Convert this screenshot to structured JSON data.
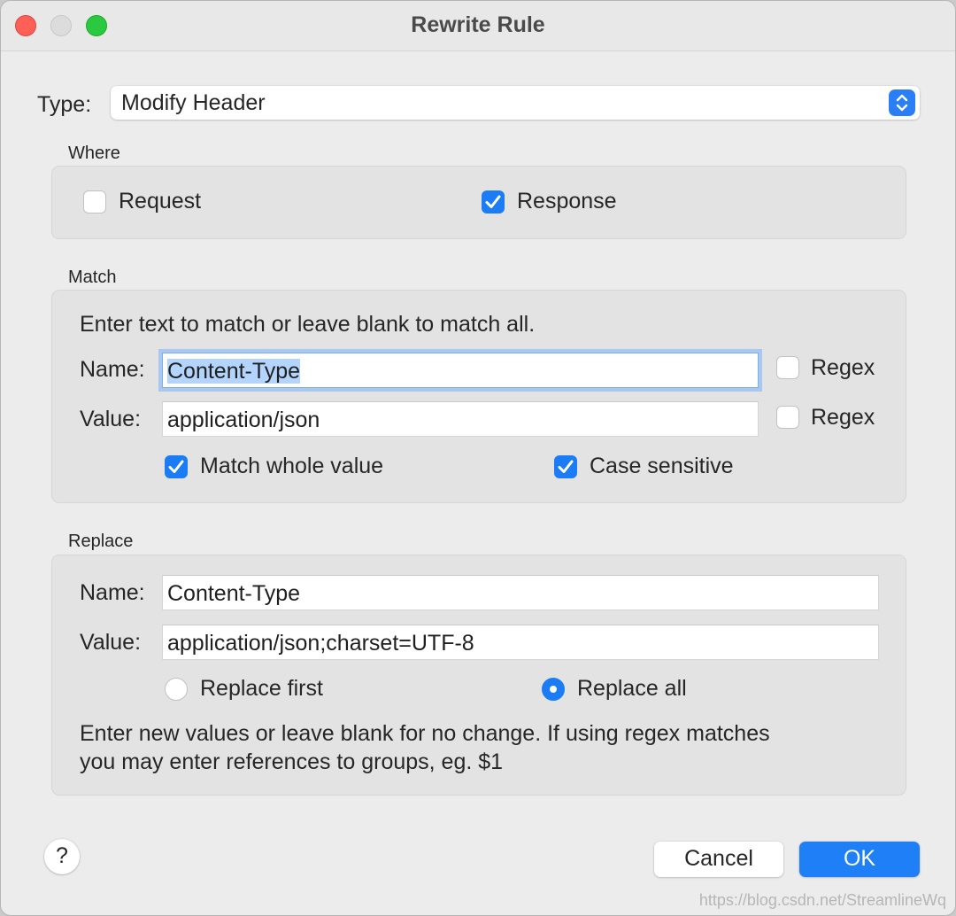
{
  "window": {
    "title": "Rewrite Rule"
  },
  "type": {
    "label": "Type:",
    "value": "Modify Header"
  },
  "where": {
    "section_label": "Where",
    "request": {
      "label": "Request",
      "checked": false
    },
    "response": {
      "label": "Response",
      "checked": true
    }
  },
  "match": {
    "section_label": "Match",
    "hint": "Enter text to match or leave blank to match all.",
    "name_label": "Name:",
    "name_value": "Content-Type",
    "name_regex": {
      "label": "Regex",
      "checked": false
    },
    "value_label": "Value:",
    "value_value": "application/json",
    "value_regex": {
      "label": "Regex",
      "checked": false
    },
    "match_whole_value": {
      "label": "Match whole value",
      "checked": true
    },
    "case_sensitive": {
      "label": "Case sensitive",
      "checked": true
    }
  },
  "replace": {
    "section_label": "Replace",
    "name_label": "Name:",
    "name_value": "Content-Type",
    "value_label": "Value:",
    "value_value": "application/json;charset=UTF-8",
    "replace_first": {
      "label": "Replace first",
      "selected": false
    },
    "replace_all": {
      "label": "Replace all",
      "selected": true
    },
    "hint_line1": "Enter new values or leave blank for no change. If using regex matches",
    "hint_line2": "you may enter references to groups, eg. $1"
  },
  "footer": {
    "help_label": "?",
    "cancel_label": "Cancel",
    "ok_label": "OK",
    "watermark": "https://blog.csdn.net/StreamlineWq"
  },
  "colors": {
    "accent": "#1f7ff7",
    "close": "#fe5f57",
    "maximize": "#2ac940"
  }
}
